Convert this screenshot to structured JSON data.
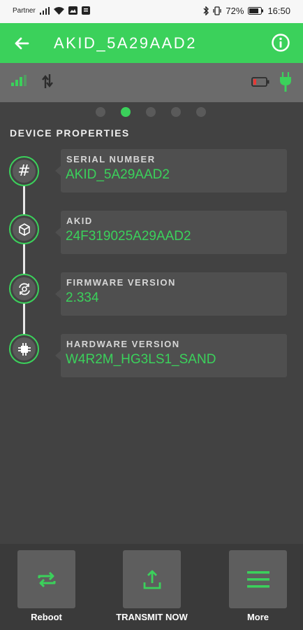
{
  "status_bar": {
    "carrier": "Partner",
    "battery_percent": "72%",
    "time": "16:50"
  },
  "app_bar": {
    "title": "AKID_5A29AAD2",
    "back_icon": "arrow-left-icon",
    "info_icon": "info-circle-icon"
  },
  "info_strip": {
    "signal_icon": "signal-bars-icon",
    "sync_icon": "sync-arrows-icon",
    "battery_icon": "battery-low-icon",
    "plug_icon": "power-plug-icon"
  },
  "pager": {
    "count": 5,
    "active_index": 1
  },
  "section": {
    "title": "DEVICE PROPERTIES"
  },
  "properties": [
    {
      "label": "SERIAL NUMBER",
      "value": "AKID_5A29AAD2",
      "icon": "hash-icon"
    },
    {
      "label": "AKID",
      "value": "24F319025A29AAD2",
      "icon": "cube-icon"
    },
    {
      "label": "FIRMWARE VERSION",
      "value": "2.334",
      "icon": "gear-sync-icon"
    },
    {
      "label": "HARDWARE VERSION",
      "value": "W4R2M_HG3LS1_SAND",
      "icon": "chip-icon"
    }
  ],
  "actions": [
    {
      "label": "Reboot",
      "icon": "repeat-icon"
    },
    {
      "label": "TRANSMIT NOW",
      "icon": "upload-icon"
    },
    {
      "label": "More",
      "icon": "menu-icon"
    }
  ],
  "colors": {
    "accent": "#3bd15b",
    "background": "#424242",
    "strip": "#6b6b6b",
    "card": "#4f4f4f",
    "battery_low": "#e53935"
  }
}
